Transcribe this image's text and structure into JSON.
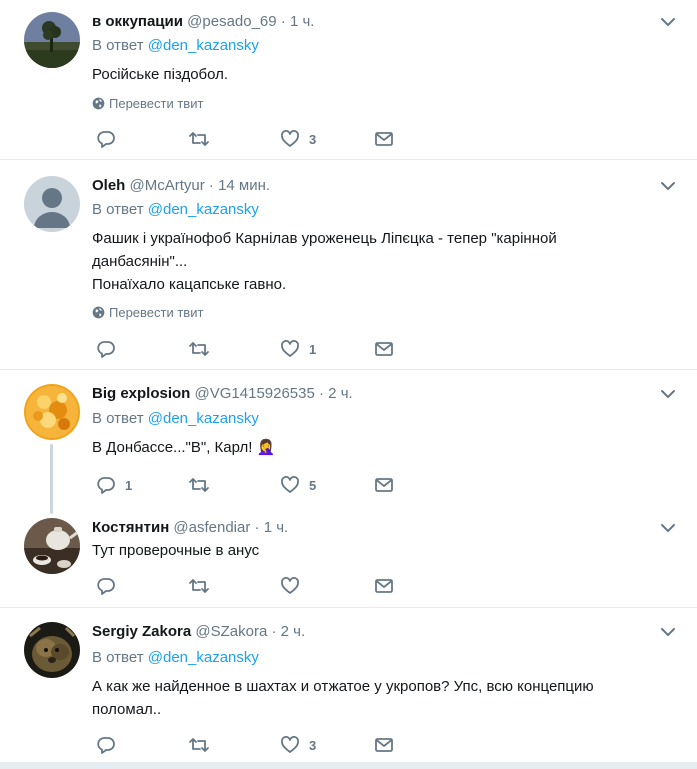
{
  "ui": {
    "reply_prefix": "В ответ",
    "translate_label": "Перевести твит"
  },
  "tweets": [
    {
      "name": "в оккупации",
      "handle": "@pesado_69",
      "time": "· 1 ч.",
      "reply_to": "@den_kazansky",
      "lines": [
        "Російське піздобол."
      ],
      "replies": "",
      "retweets": "",
      "likes": "3",
      "avatar": "tree-avatar"
    },
    {
      "name": "Oleh",
      "handle": "@McArtyur",
      "time": "· 14 мин.",
      "reply_to": "@den_kazansky",
      "lines": [
        "Фашик і українофоб Карнілав уроженець Ліпєцка - тепер \"карінной",
        "данбасянін\"...",
        "Понаїхало кацапське гавно."
      ],
      "replies": "",
      "retweets": "",
      "likes": "1",
      "avatar": "default-avatar"
    },
    {
      "name": "Big explosion",
      "handle": "@VG1415926535",
      "time": "· 2 ч.",
      "reply_to": "@den_kazansky",
      "lines": [
        "В Донбассе...\"В\", Карл! 🤦‍♀️"
      ],
      "replies": "1",
      "retweets": "",
      "likes": "5",
      "avatar": "explosion-avatar"
    },
    {
      "name": "Костянтин",
      "handle": "@asfendiar",
      "time": "· 1 ч.",
      "reply_to": "",
      "lines": [
        "Тут проверочные в анус"
      ],
      "replies": "",
      "retweets": "",
      "likes": "",
      "avatar": "teapot-avatar"
    },
    {
      "name": "Sergiy Zakora",
      "handle": "@SZakora",
      "time": "· 2 ч.",
      "reply_to": "@den_kazansky",
      "lines": [
        "А как же найденное в шахтах и отжатое у укропов? Упс, всю концепцию",
        "поломал.."
      ],
      "replies": "",
      "retweets": "",
      "likes": "3",
      "avatar": "dog-avatar"
    }
  ],
  "colors": {
    "link": "#1da1f2",
    "muted": "#657786",
    "text": "#14171a",
    "separator": "#e6ecf0",
    "thread": "#ccd6dd"
  }
}
